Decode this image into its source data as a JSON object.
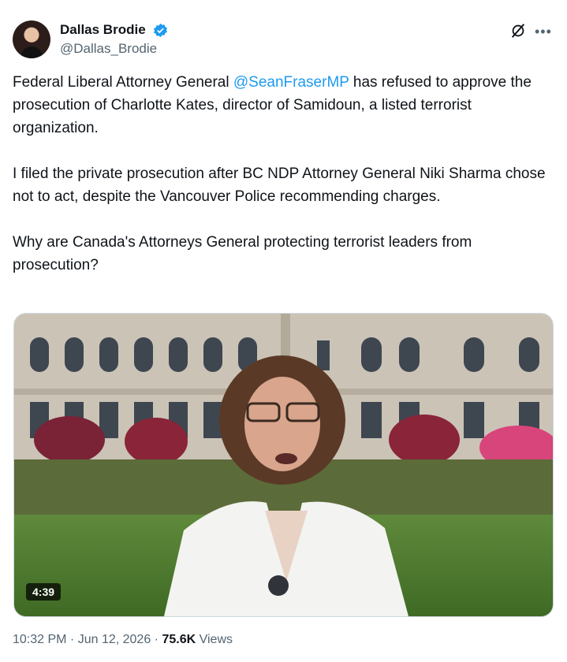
{
  "author": {
    "name": "Dallas Brodie",
    "handle": "@Dallas_Brodie"
  },
  "icons": {
    "grok": "grok-icon",
    "more": "more-options-icon",
    "verified": "verified-badge-icon"
  },
  "tweet": {
    "p1_before": "Federal Liberal Attorney General ",
    "p1_mention": "@SeanFraserMP",
    "p1_after": " has refused to approve the prosecution of Charlotte Kates, director of Samidoun, a listed terrorist organization.",
    "p2": "I filed the private prosecution after BC NDP Attorney General Niki Sharma chose not to act, despite the Vancouver Police recommending charges.",
    "p3": "Why are Canada's Attorneys General protecting terrorist leaders from prosecution?"
  },
  "media": {
    "duration": "4:39"
  },
  "meta": {
    "time": "10:32 PM",
    "sep": " · ",
    "date": "Jun 12, 2026",
    "sep2": " · ",
    "views_count": "75.6K",
    "views_label": " Views"
  },
  "colors": {
    "accent": "#1d9bf0",
    "muted": "#536471",
    "text": "#0f1419"
  }
}
